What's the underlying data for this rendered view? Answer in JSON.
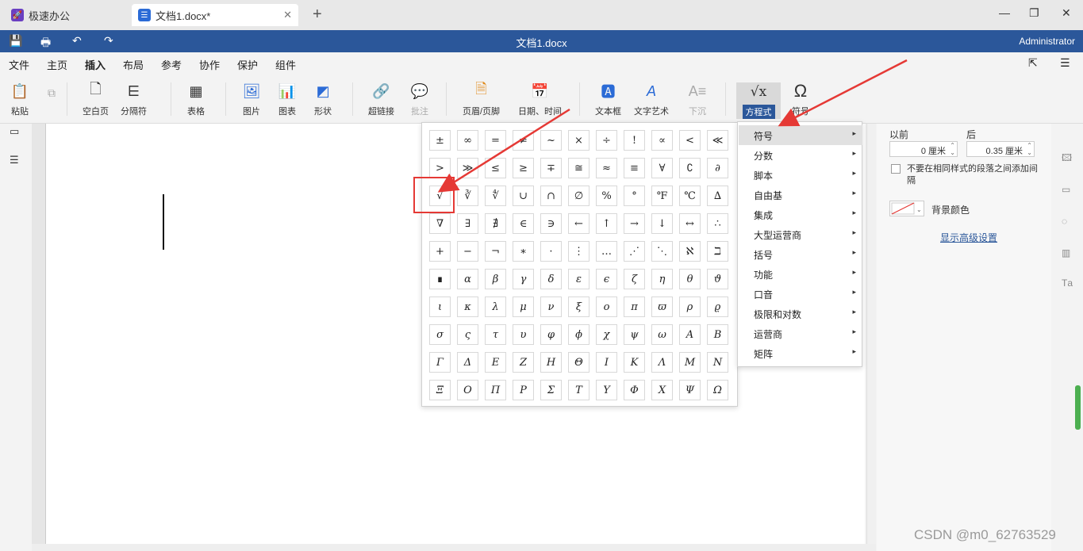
{
  "tabs": [
    {
      "label": "极速办公",
      "icon": "rocket-icon",
      "color": "#6a3fc1"
    },
    {
      "label": "文档1.docx*",
      "icon": "document-icon",
      "color": "#2b6bd6"
    }
  ],
  "window": {
    "title": "文档1.docx",
    "user": "Administrator"
  },
  "menu": [
    "文件",
    "主页",
    "插入",
    "布局",
    "参考",
    "协作",
    "保护",
    "组件"
  ],
  "active_menu": "插入",
  "ribbon": {
    "paste": "粘贴",
    "blank_page": "空白页",
    "separator": "分隔符",
    "table": "表格",
    "picture": "图片",
    "chart": "图表",
    "shape": "形状",
    "hyperlink": "超链接",
    "comment": "批注",
    "header_footer": "页眉/页脚",
    "datetime": "日期、时间",
    "textbox": "文本框",
    "textart": "文字艺术",
    "dropcap": "下沉",
    "equation": "方程式",
    "symbol": "符号"
  },
  "symbols": [
    [
      "±",
      "∞",
      "=",
      "≠",
      "~",
      "×",
      "÷",
      "!",
      "∝",
      "<",
      "≪"
    ],
    [
      ">",
      "≫",
      "≤",
      "≥",
      "∓",
      "≅",
      "≈",
      "≡",
      "∀",
      "∁",
      "∂"
    ],
    [
      "√",
      "∛",
      "∜",
      "∪",
      "∩",
      "∅",
      "%",
      "°",
      "℉",
      "℃",
      "∆"
    ],
    [
      "∇",
      "∃",
      "∄",
      "∈",
      "∋",
      "←",
      "↑",
      "→",
      "↓",
      "↔",
      "∴"
    ],
    [
      "+",
      "−",
      "¬",
      "∗",
      "·",
      "⋮",
      "…",
      "⋰",
      "⋱",
      "ℵ",
      "ℶ"
    ],
    [
      "∎",
      "α",
      "β",
      "γ",
      "δ",
      "ε",
      "ϵ",
      "ζ",
      "η",
      "θ",
      "ϑ"
    ],
    [
      "ι",
      "κ",
      "λ",
      "μ",
      "ν",
      "ξ",
      "ο",
      "π",
      "ϖ",
      "ρ",
      "ϱ"
    ],
    [
      "σ",
      "ς",
      "τ",
      "υ",
      "φ",
      "ϕ",
      "χ",
      "ψ",
      "ω",
      "Α",
      "Β"
    ],
    [
      "Γ",
      "Δ",
      "Ε",
      "Ζ",
      "Η",
      "Θ",
      "Ι",
      "Κ",
      "Λ",
      "Μ",
      "Ν"
    ],
    [
      "Ξ",
      "Ο",
      "Π",
      "Ρ",
      "Σ",
      "Τ",
      "Υ",
      "Φ",
      "Χ",
      "Ψ",
      "Ω"
    ]
  ],
  "submenu": [
    "符号",
    "分数",
    "脚本",
    "自由基",
    "集成",
    "大型运营商",
    "括号",
    "功能",
    "口音",
    "极限和对数",
    "运营商",
    "矩阵"
  ],
  "submenu_selected": "符号",
  "panel": {
    "before_label": "以前",
    "after_label": "后",
    "before_value": "0 厘米",
    "after_value": "0.35 厘米",
    "no_space_label": "不要在相同样式的段落之间添加间隔",
    "bg_color_label": "背景颜色",
    "advanced_link": "显示高级设置"
  },
  "watermark": "CSDN @m0_62763529",
  "colors": {
    "titlebar": "#2b579a",
    "highlight": "#e53935"
  }
}
